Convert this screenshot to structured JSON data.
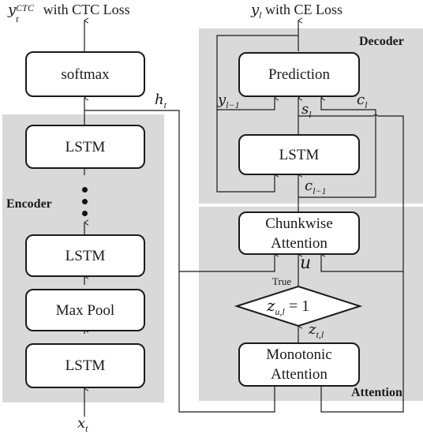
{
  "outputs": {
    "ctc": {
      "var": "y",
      "sub": "t",
      "sup": "CTC",
      "text": " with CTC Loss"
    },
    "ce": {
      "var": "y",
      "sub": "l",
      "text": " with CE Loss"
    }
  },
  "input": {
    "var": "x",
    "sub": "t"
  },
  "panels": {
    "encoder": "Encoder",
    "decoder": "Decoder",
    "attention": "Attention"
  },
  "encoder_blocks": {
    "softmax": "softmax",
    "lstm_top": "LSTM",
    "lstm_mid": "LSTM",
    "maxpool": "Max Pool",
    "lstm_bottom": "LSTM"
  },
  "decoder_blocks": {
    "prediction": "Prediction",
    "lstm": "LSTM"
  },
  "attention_blocks": {
    "chunkwise_line1": "Chunkwise",
    "chunkwise_line2": "Attention",
    "monotonic_line1": "Monotonic",
    "monotonic_line2": "Attention",
    "decision_var": "z",
    "decision_sub": "u,l",
    "decision_rhs": " = 1",
    "true_label": "True"
  },
  "signals": {
    "h": {
      "var": "h",
      "sub": "t"
    },
    "y_prev": {
      "var": "y",
      "sub": "l−1"
    },
    "s": {
      "var": "s",
      "sub": "l"
    },
    "c": {
      "var": "c",
      "sub": "l"
    },
    "c_prev": {
      "var": "c",
      "sub": "l−1"
    },
    "u": {
      "var": "u"
    },
    "z": {
      "var": "z",
      "sub": "t,l"
    }
  },
  "colors": {
    "panel": "#d9d9d9",
    "line": "#1a1a1a",
    "box_fill": "#ffffff"
  }
}
